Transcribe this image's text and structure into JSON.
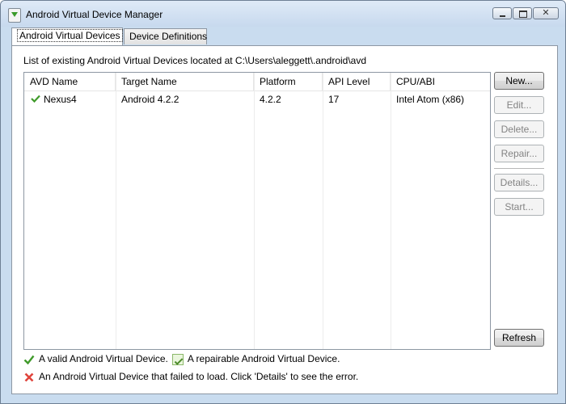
{
  "window": {
    "title": "Android Virtual Device Manager"
  },
  "tabs": [
    {
      "label": "Android Virtual Devices",
      "active": true
    },
    {
      "label": "Device Definitions",
      "active": false
    }
  ],
  "path_label": "List of existing Android Virtual Devices located at C:\\Users\\aleggett\\.android\\avd",
  "table": {
    "columns": [
      "AVD Name",
      "Target Name",
      "Platform",
      "API Level",
      "CPU/ABI"
    ],
    "rows": [
      {
        "status": "valid",
        "cells": [
          "Nexus4",
          "Android 4.2.2",
          "4.2.2",
          "17",
          "Intel Atom (x86)"
        ]
      }
    ]
  },
  "buttons": {
    "new": "New...",
    "edit": "Edit...",
    "delete": "Delete...",
    "repair": "Repair...",
    "details": "Details...",
    "start": "Start...",
    "refresh": "Refresh"
  },
  "legend": {
    "valid": "A valid Android Virtual Device.",
    "repairable": "A repairable Android Virtual Device.",
    "failed": "An Android Virtual Device that failed to load. Click 'Details' to see the error."
  },
  "colors": {
    "valid": "#3f9a2a",
    "failed": "#e0443c",
    "accent": "#c9dcef"
  },
  "icons": {
    "valid": "check-icon",
    "repairable": "repair-icon",
    "failed": "error-x-icon"
  }
}
